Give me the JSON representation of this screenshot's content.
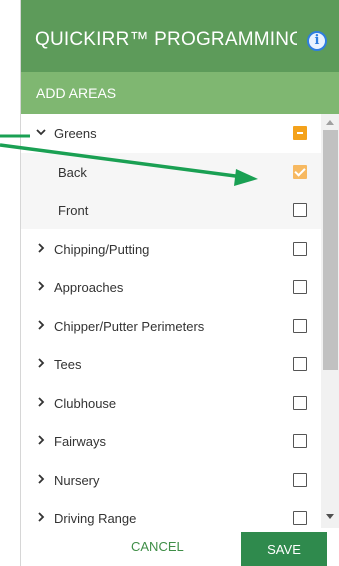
{
  "colors": {
    "header": "#5d9b5a",
    "subheader": "#7fb771",
    "checkbox_partial": "#f4a21b",
    "checkbox_checked": "#f7b961",
    "save_button": "#2f8a4d",
    "annotation_arrow": "#1aa053"
  },
  "header": {
    "title": "QUICKIRR™ PROGRAMMING",
    "info_icon": "i"
  },
  "subheader": {
    "title": "ADD AREAS"
  },
  "list": {
    "items": [
      {
        "label": "Greens",
        "expanded": true,
        "state": "partial",
        "level": 0
      },
      {
        "label": "Back",
        "state": "checked",
        "level": 1
      },
      {
        "label": "Front",
        "state": "unchecked",
        "level": 1
      },
      {
        "label": "Chipping/Putting",
        "expanded": false,
        "state": "unchecked",
        "level": 0
      },
      {
        "label": "Approaches",
        "expanded": false,
        "state": "unchecked",
        "level": 0
      },
      {
        "label": "Chipper/Putter Perimeters",
        "expanded": false,
        "state": "unchecked",
        "level": 0
      },
      {
        "label": "Tees",
        "expanded": false,
        "state": "unchecked",
        "level": 0
      },
      {
        "label": "Clubhouse",
        "expanded": false,
        "state": "unchecked",
        "level": 0
      },
      {
        "label": "Fairways",
        "expanded": false,
        "state": "unchecked",
        "level": 0
      },
      {
        "label": "Nursery",
        "expanded": false,
        "state": "unchecked",
        "level": 0
      },
      {
        "label": "Driving Range",
        "expanded": false,
        "state": "unchecked",
        "level": 0
      }
    ]
  },
  "footer": {
    "cancel_label": "CANCEL",
    "save_label": "SAVE"
  }
}
